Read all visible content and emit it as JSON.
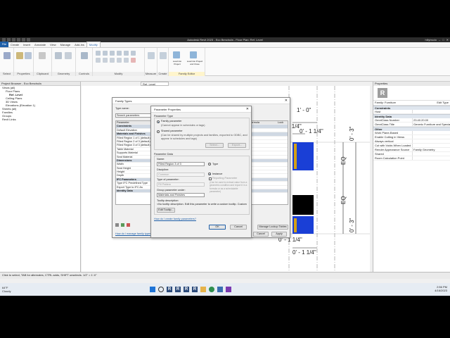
{
  "window": {
    "title": "Autodesk Revit 2023 - Eco Benchufa - Floor Plan: Ref. Level",
    "user": "hillybsolo"
  },
  "ribbon_tabs": [
    "File",
    "Create",
    "Insert",
    "Annotate",
    "View",
    "Manage",
    "Add-Ins",
    "Modify"
  ],
  "active_tab": "Modify",
  "ribbon_panels": [
    "Select",
    "Properties",
    "Clipboard",
    "Geometry",
    "Controls",
    "Modify",
    "Measure",
    "Create",
    "Family Editor"
  ],
  "ribbon_buttons": [
    "Load into Project",
    "Load into Project and Close"
  ],
  "project_browser": {
    "title": "Project Browser - Eco Benchufa",
    "items": [
      {
        "label": "Views (all)",
        "level": 0
      },
      {
        "label": "Floor Plans",
        "level": 1
      },
      {
        "label": "Ref. Level",
        "level": 2,
        "selected": true
      },
      {
        "label": "Ceiling Plans",
        "level": 1
      },
      {
        "label": "3D Views",
        "level": 1
      },
      {
        "label": "Elevations (Elevation 1)",
        "level": 1
      },
      {
        "label": "Sheets (all)",
        "level": 0
      },
      {
        "label": "Families",
        "level": 0
      },
      {
        "label": "Groups",
        "level": 0
      },
      {
        "label": "Revit Links",
        "level": 0
      }
    ]
  },
  "view_tab": "Ref. Level",
  "drawing": {
    "dims": [
      "1' - 0\"",
      "0' - 1 1/4\"",
      "0' - 1 1/4\"",
      "0' - 3\"",
      "EQ",
      "EQ",
      "0' - 3\"",
      "0' - 1 1/4\"",
      "0' - 1 1/4\""
    ],
    "colors": {
      "blue": "#1a3fd6",
      "black": "#000000"
    }
  },
  "properties": {
    "title": "Properties",
    "type_select": "Family: Furniture",
    "edit_type": "Edit Type",
    "sections": [
      {
        "name": "Constraints",
        "rows": [
          [
            "Host",
            ""
          ]
        ]
      },
      {
        "name": "Identity Data",
        "rows": [
          [
            "OmniClass Number",
            "23.40.20.00"
          ],
          [
            "OmniClass Title",
            "Generic Furniture and Specialty..."
          ]
        ]
      },
      {
        "name": "Other",
        "rows": [
          [
            "Work Plane-Based",
            ""
          ],
          [
            "Enable Cutting in Views",
            ""
          ],
          [
            "Always vertical",
            ""
          ],
          [
            "Cut with Voids When Loaded",
            ""
          ],
          [
            "Render Appearance Source",
            "Family Geometry"
          ],
          [
            "Shared",
            ""
          ],
          [
            "Room Calculation Point",
            ""
          ]
        ]
      }
    ],
    "help_link": "Properties help",
    "apply": "Apply"
  },
  "family_types": {
    "title": "Family Types",
    "type_name_label": "Type name:",
    "search_placeholder": "Search parameters",
    "col_parameter": "Parameter",
    "col_value": "Value",
    "col_formula": "Formula",
    "col_lock": "Lock",
    "rows": [
      {
        "label": "Constraints",
        "sec": true
      },
      {
        "label": "Default Elevation"
      },
      {
        "label": "Materials and Finishes",
        "sec": true
      },
      {
        "label": "Filled Region 1 of 1 (default)"
      },
      {
        "label": "Filled Region 2 of 3 (default)"
      },
      {
        "label": "Filled Region 3 of 3 (default)"
      },
      {
        "label": "Table Material"
      },
      {
        "label": "Supports Material"
      },
      {
        "label": "Seat Material"
      },
      {
        "label": "Dimensions",
        "sec": true
      },
      {
        "label": "Width"
      },
      {
        "label": "Seat Height"
      },
      {
        "label": "Height"
      },
      {
        "label": "Depth"
      },
      {
        "label": "IFC Parameters",
        "sec": true
      },
      {
        "label": "Type IFC Predefined Type"
      },
      {
        "label": "Export Type to IFC As"
      },
      {
        "label": "Identity Data",
        "sec": true
      }
    ],
    "manage_lookup": "Manage Lookup Tables",
    "help_link": "How do I manage family types?",
    "ok": "OK",
    "cancel": "Cancel",
    "apply": "Apply"
  },
  "param_props": {
    "title": "Parameter Properties",
    "param_type_label": "Parameter Type",
    "family_param": "Family parameter",
    "family_param_desc": "(Cannot appear in schedules or tags)",
    "shared_param": "Shared parameter",
    "shared_param_desc": "(Can be shared by multiple projects and families, exported to ODBC, and appear in schedules and tags)",
    "select_btn": "Select...",
    "export_btn": "Export...",
    "param_data_label": "Parameter Data",
    "name_label": "Name:",
    "name_value": "Filled Region 3 of 3",
    "type_opt": "Type",
    "instance_opt": "Instance",
    "discipline_label": "Discipline:",
    "discipline_value": "Common",
    "reporting_label": "Reporting Parameter",
    "reporting_desc": "(Can be used to extract value from a geometric condition and report it in a formula or as a schedulable parameter)",
    "type_of_param_label": "Type of parameter:",
    "type_of_param_value": "Fill Pattern",
    "group_label": "Group parameter under:",
    "group_value": "Materials and Finishes",
    "tooltip_label": "Tooltip description:",
    "tooltip_value": "<No tooltip description. Edit this parameter to write a custom tooltip. Custom",
    "edit_tooltip_btn": "Edit Tooltip...",
    "help_link": "How do I create family parameters?",
    "ok": "OK",
    "cancel": "Cancel"
  },
  "status": {
    "scale": "1/2\" = 1'-0\"",
    "click_hint": "Click to select, TAB for alternates, CTRL adds, SHIFT unselects."
  },
  "taskbar": {
    "weather": "64°F",
    "weather_desc": "Cloudy",
    "time": "2:56 PM",
    "date": "4/16/2023"
  }
}
